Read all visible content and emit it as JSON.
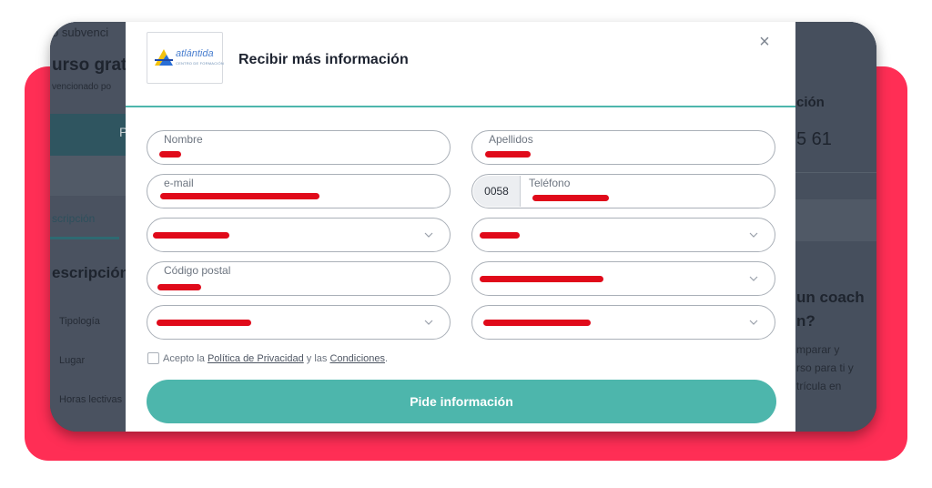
{
  "background_page": {
    "subsidy_text": "o subvenci",
    "course_title": "urso grat",
    "course_sub": "vencionado po",
    "bar_letter": "P",
    "tab_label": "scripción",
    "section_heading": "escripción",
    "rows": [
      "Tipología",
      "Lugar",
      "Horas lectivas"
    ],
    "right_heading": "ción",
    "right_number": "5 61",
    "coach_heading_1": "un coach",
    "coach_heading_2": "n?",
    "coach_text": [
      "mparar y",
      "rso para ti y",
      "trícula en"
    ]
  },
  "modal": {
    "logo_text": "atlántida",
    "logo_subtext": "CENTRO DE FORMACIÓN",
    "title": "Recibir más información",
    "close_symbol": "×",
    "fields": {
      "nombre_label": "Nombre",
      "apellidos_label": "Apellidos",
      "email_label": "e-mail",
      "phone_prefix": "0058",
      "telefono_label": "Teléfono",
      "codigo_postal_label": "Código postal"
    },
    "consent": {
      "prefix": "Acepto la",
      "privacy_link": "Política de Privacidad",
      "middle": "y las",
      "conditions_link": "Condiciones",
      "suffix": "."
    },
    "submit_label": "Pide información"
  },
  "colors": {
    "accent_teal": "#4db6ac",
    "backdrop_red": "#ff2e55",
    "redaction_red": "#e00a1a"
  },
  "icons": [
    "close-icon",
    "chevron-down-icon",
    "atlantida-logo"
  ]
}
